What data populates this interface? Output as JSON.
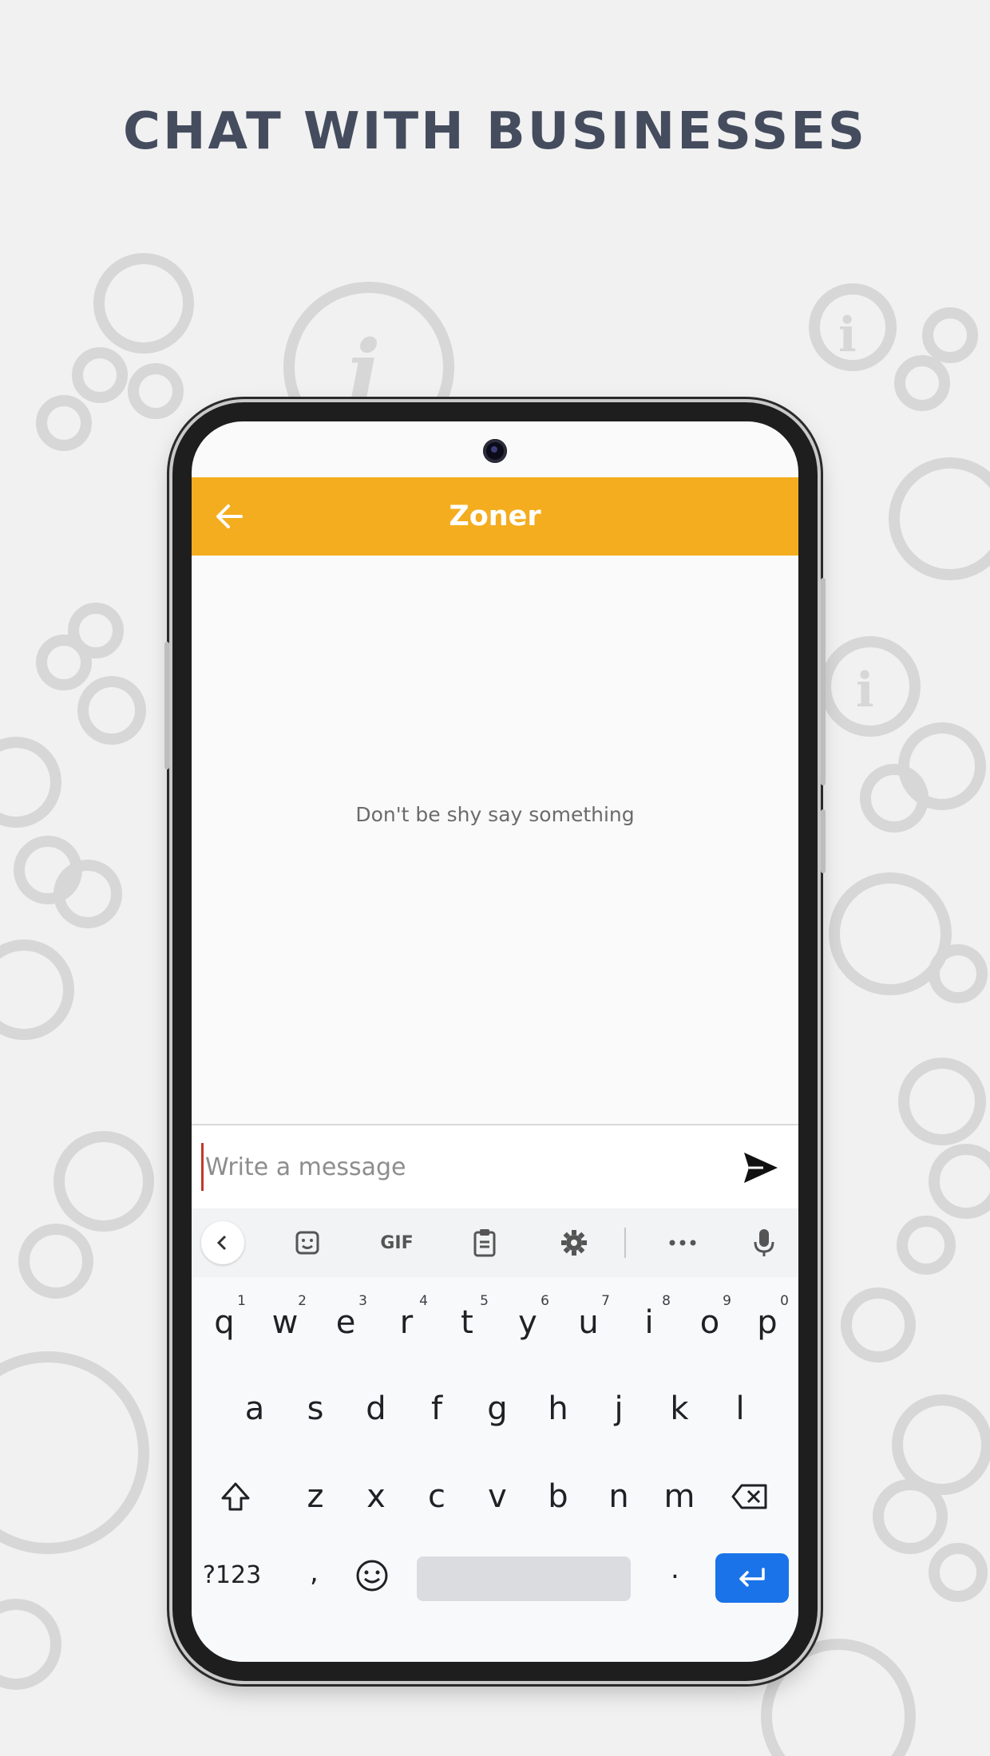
{
  "headline": "CHAT WITH BUSINESSES",
  "app": {
    "title": "Zoner",
    "empty_state": "Don't be shy say something",
    "composer": {
      "placeholder": "Write a message"
    }
  },
  "keyboard": {
    "toolbar": [
      "back",
      "sticker-icon",
      "GIF",
      "clipboard-icon",
      "gear-icon",
      "more-icon",
      "mic-icon"
    ],
    "gif_label": "GIF",
    "row1": [
      {
        "k": "q",
        "h": "1"
      },
      {
        "k": "w",
        "h": "2"
      },
      {
        "k": "e",
        "h": "3"
      },
      {
        "k": "r",
        "h": "4"
      },
      {
        "k": "t",
        "h": "5"
      },
      {
        "k": "y",
        "h": "6"
      },
      {
        "k": "u",
        "h": "7"
      },
      {
        "k": "i",
        "h": "8"
      },
      {
        "k": "o",
        "h": "9"
      },
      {
        "k": "p",
        "h": "0"
      }
    ],
    "row2": [
      "a",
      "s",
      "d",
      "f",
      "g",
      "h",
      "j",
      "k",
      "l"
    ],
    "row3": [
      "z",
      "x",
      "c",
      "v",
      "b",
      "n",
      "m"
    ],
    "symbols_label": "?123",
    "comma": ",",
    "period": "."
  },
  "colors": {
    "appbar": "#f4ad1f",
    "enter": "#1a73e8",
    "headline": "#444c5e"
  }
}
